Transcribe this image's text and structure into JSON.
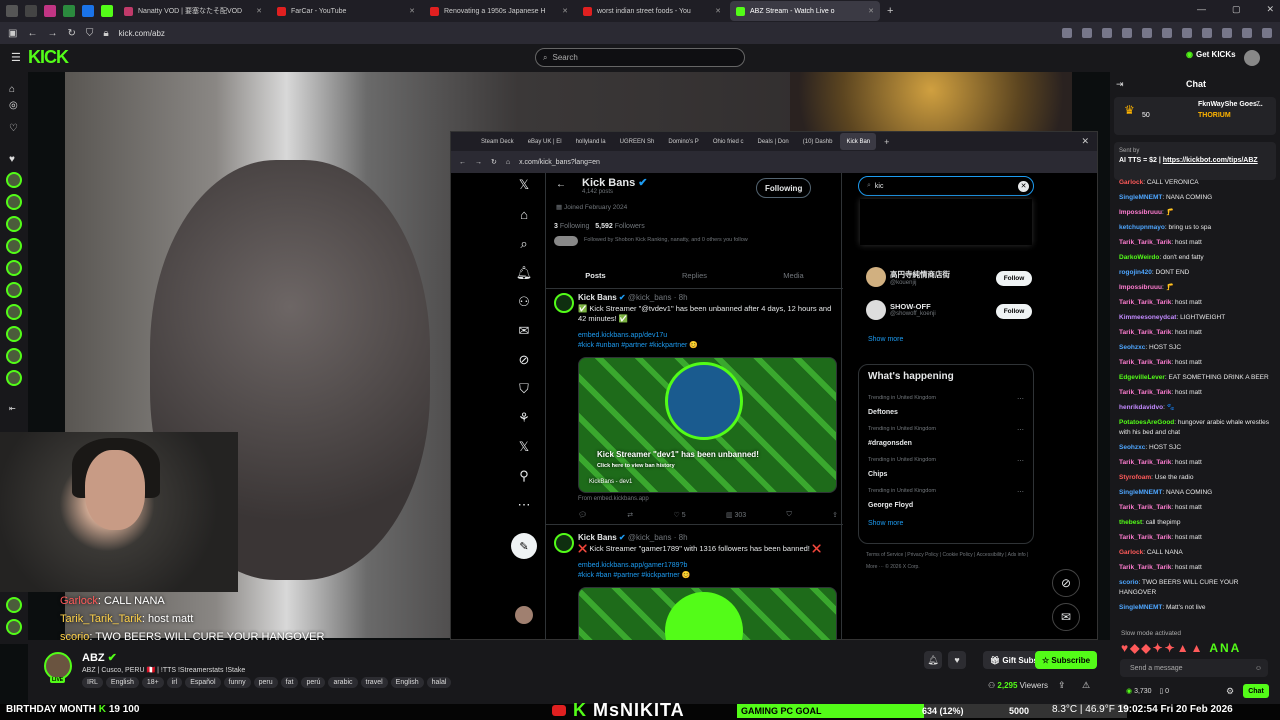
{
  "browser": {
    "tabs": [
      {
        "label": "Nanatty VOD | 要塞なたそ配VOD",
        "color": "#c03a6a"
      },
      {
        "label": "FarCar - YouTube",
        "color": "#e02020"
      },
      {
        "label": "Renovating a 1950s Japanese H",
        "color": "#e02020"
      },
      {
        "label": "worst indian street foods - You",
        "color": "#e02020"
      },
      {
        "label": "ABZ Stream - Watch Live o",
        "color": "#53fc18"
      }
    ],
    "url": "kick.com/abz"
  },
  "kick": {
    "logo": "KICK",
    "search_placeholder": "Search",
    "get_kicks": "Get KICKs"
  },
  "overlay_chat": [
    {
      "user": "Garlock",
      "text": ": CALL NANA"
    },
    {
      "user": "Tarik_Tarik_Tarik",
      "text": ": host matt"
    },
    {
      "user": "scorio",
      "text": ": TWO BEERS WILL CURE YOUR HANGOVER"
    }
  ],
  "stream": {
    "name": "ABZ",
    "title": "ABZ | Cusco, PERU 🇵🇪 | !TTS !Streamerstats !Stake",
    "tags": [
      "IRL",
      "English",
      "18+",
      "irl",
      "Español",
      "funny",
      "peru",
      "fat",
      "perú",
      "arabic",
      "travel",
      "English",
      "halal"
    ],
    "gift_subs": "Gift Subs",
    "subscribe": "Subscribe",
    "viewers": "2,295",
    "viewers_label": "Viewers",
    "live": "LIVE"
  },
  "ticker": {
    "left": "BIRTHDAY MONTH",
    "left_n1": "19",
    "left_n2": "100",
    "channel": "MsNIKITA",
    "goal_label": "GAMING PC GOAL",
    "goal_amount": "634 (12%)",
    "goal_target": "5000",
    "goal_fraction": 0.12,
    "weather": "8.3°C | 46.9°F",
    "time": "19:02:54",
    "date": "Fri 20 Feb 2026"
  },
  "popup": {
    "tabs": [
      "Steam Deck",
      "eBay UK | El",
      "hollyland la",
      "UGREEN Sh",
      "Domino's P",
      "Ohio fried c",
      "Deals | Don",
      "(10) Dashb",
      "Kick Ban"
    ],
    "url": "x.com/kick_bans?lang=en"
  },
  "x": {
    "profile": {
      "name": "Kick Bans",
      "posts": "4,142 posts",
      "joined": "Joined February 2024",
      "following_count": "3",
      "following_label": "Following",
      "followers_count": "5,592",
      "followers_label": "Followers",
      "followed_by": "Followed by Shobon Kick Ranking, nanatty, and 0 others you follow",
      "follow_button": "Following"
    },
    "tabs": [
      "Posts",
      "Replies",
      "Media"
    ],
    "tweets": [
      {
        "name": "Kick Bans",
        "handle": "@kick_bans · 8h",
        "text": "✅ Kick Streamer \"@tvdev1\" has been unbanned after 4 days, 12 hours and 42 minutes! ✅",
        "link": "embed.kickbans.app/dev17u",
        "hashtags": "#kick #unban #partner #kickpartner 😊",
        "card_title": "Kick Streamer \"dev1\" has been unbanned!",
        "card_sub": "Click here to view ban history",
        "card_caption": "KickBans - dev1",
        "from": "From embed.kickbans.app",
        "likes": "5",
        "views": "303"
      },
      {
        "name": "Kick Bans",
        "handle": "@kick_bans · 8h",
        "text": "❌ Kick Streamer \"gamer1789\" with 1316 followers has been banned! ❌",
        "link": "embed.kickbans.app/gamer1789?b",
        "hashtags": "#kick #ban #partner #kickpartner 😊"
      }
    ],
    "search_value": "kic",
    "who_to_follow": [
      {
        "name": "高円寺純情商店街",
        "handle": "@kouenjij",
        "button": "Follow"
      },
      {
        "name": "SHOW-OFF",
        "handle": "@showoff_koenji",
        "button": "Follow"
      }
    ],
    "show_more": "Show more",
    "happening_title": "What's happening",
    "trends": [
      {
        "context": "Trending in United Kingdom",
        "topic": "Deftones"
      },
      {
        "context": "Trending in United Kingdom",
        "topic": "#dragonsden"
      },
      {
        "context": "Trending in United Kingdom",
        "topic": "Chips"
      },
      {
        "context": "Trending in United Kingdom",
        "topic": "George Floyd"
      }
    ],
    "footer": "Terms of Service | Privacy Policy | Cookie Policy | Accessibility | Ads info | More ··· © 2026 X Corp."
  },
  "chat": {
    "title": "Chat",
    "pinned_user": "FknWayShe Goes...",
    "pinned_label": "THORIUM",
    "pinned_count": "50",
    "pinned_n": "7",
    "tts_sent_by": "Sent by",
    "tts_text": "AI TTS = $2 |",
    "tts_link": "https://kickbot.com/tips/ABZ",
    "messages": [
      {
        "user": "Garlock",
        "color": "#ff5a5a",
        "text": "CALL VERONICA"
      },
      {
        "user": "SingleMNEMT",
        "color": "#4ea6ff",
        "text": "NANA COMING"
      },
      {
        "user": "Impossibruuu",
        "color": "#ff7dd1",
        "text": "🦵"
      },
      {
        "user": "ketchupnmayo",
        "color": "#4ea6ff",
        "text": "bring us to spa"
      },
      {
        "user": "Tarik_Tarik_Tarik",
        "color": "#ff7dd1",
        "text": "host matt"
      },
      {
        "user": "DarkoWeirdo",
        "color": "#53fc18",
        "text": "don't end fatty"
      },
      {
        "user": "rogojin420",
        "color": "#4ea6ff",
        "text": "DONT END"
      },
      {
        "user": "Impossibruuu",
        "color": "#ff7dd1",
        "text": "🦵"
      },
      {
        "user": "Tarik_Tarik_Tarik",
        "color": "#ff7dd1",
        "text": "host matt"
      },
      {
        "user": "Kimmeesoneydcat",
        "color": "#c38aff",
        "text": "LIGHTWEIGHT"
      },
      {
        "user": "Tarik_Tarik_Tarik",
        "color": "#ff7dd1",
        "text": "host matt"
      },
      {
        "user": "Seohzxc",
        "color": "#4ea6ff",
        "text": "HOST SJC"
      },
      {
        "user": "Tarik_Tarik_Tarik",
        "color": "#ff7dd1",
        "text": "host matt"
      },
      {
        "user": "EdgevilleLever",
        "color": "#53fc18",
        "text": "EAT SOMETHING DRINK A BEER"
      },
      {
        "user": "Tarik_Tarik_Tarik",
        "color": "#ff7dd1",
        "text": "host matt"
      },
      {
        "user": "henrikdavidvo",
        "color": "#c38aff",
        "text": "🐾"
      },
      {
        "user": "PotatoesAreGood",
        "color": "#53fc18",
        "text": "hungover arabic whale wrestles with his bed and chat"
      },
      {
        "user": "Seohzxc",
        "color": "#4ea6ff",
        "text": "HOST SJC"
      },
      {
        "user": "Tarik_Tarik_Tarik",
        "color": "#ff7dd1",
        "text": "host matt"
      },
      {
        "user": "Styrofoam",
        "color": "#ff5a5a",
        "text": "Use the radio"
      },
      {
        "user": "SingleMNEMT",
        "color": "#4ea6ff",
        "text": "NANA COMING"
      },
      {
        "user": "Tarik_Tarik_Tarik",
        "color": "#ff7dd1",
        "text": "host matt"
      },
      {
        "user": "thebest",
        "color": "#53fc18",
        "text": "call thepimp"
      },
      {
        "user": "Tarik_Tarik_Tarik",
        "color": "#ff7dd1",
        "text": "host matt"
      },
      {
        "user": "Garlock",
        "color": "#ff5a5a",
        "text": "CALL NANA"
      },
      {
        "user": "Tarik_Tarik_Tarik",
        "color": "#ff7dd1",
        "text": "host matt"
      },
      {
        "user": "scorio",
        "color": "#4ea6ff",
        "text": "TWO BEERS WILL CURE YOUR HANGOVER"
      },
      {
        "user": "SingleMNEMT",
        "color": "#4ea6ff",
        "text": "Matt's not live"
      }
    ],
    "slow_mode": "Slow mode activated",
    "emote_text": "ANA",
    "input_placeholder": "Send a message",
    "kicks_balance": "3,730",
    "kicks_zero": "0",
    "chat_button": "Chat"
  },
  "colors": {
    "kick_green": "#53fc18",
    "x_blue": "#1d9bf0"
  }
}
